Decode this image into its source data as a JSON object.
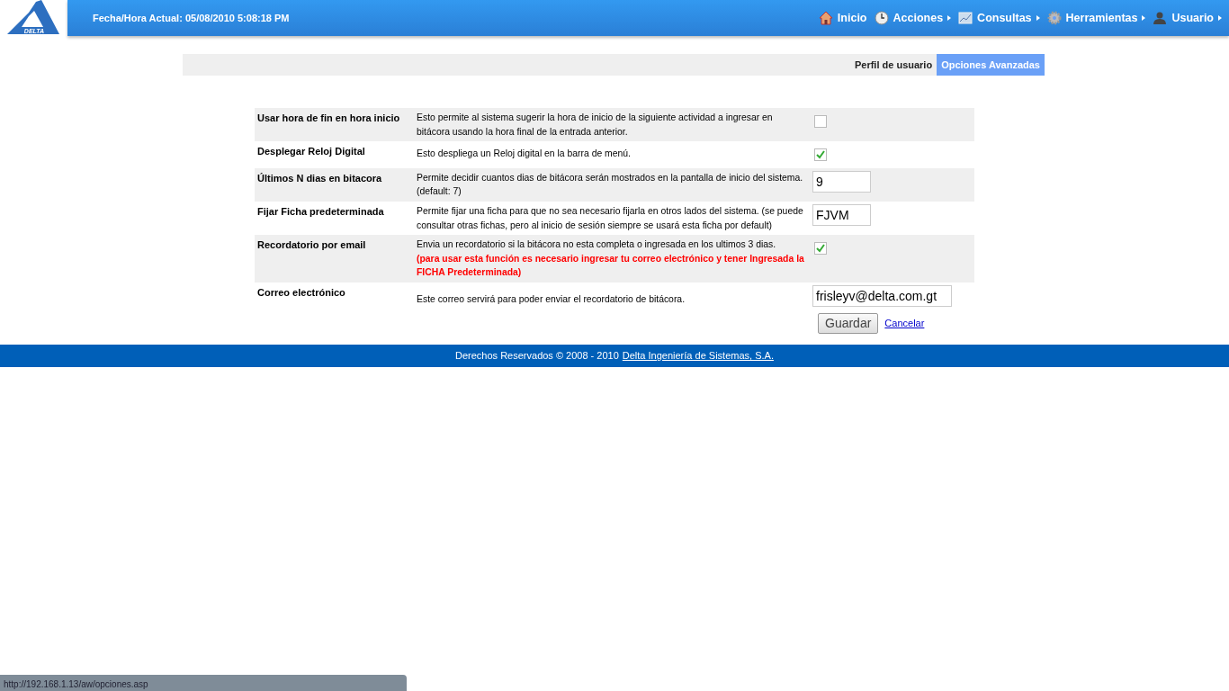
{
  "header": {
    "logo_text": "DELTA",
    "datetime": "Fecha/Hora Actual: 05/08/2010 5:08:18 PM"
  },
  "menu": [
    {
      "label": "Inicio",
      "has_submenu": false
    },
    {
      "label": "Acciones",
      "has_submenu": true
    },
    {
      "label": "Consultas",
      "has_submenu": true
    },
    {
      "label": "Herramientas",
      "has_submenu": true
    },
    {
      "label": "Usuario",
      "has_submenu": true
    }
  ],
  "tabs": [
    {
      "label": "Perfil de usuario",
      "selected": false
    },
    {
      "label": "Opciones Avanzadas",
      "selected": true
    }
  ],
  "options": [
    {
      "label": "Usar hora de fin en hora inicio",
      "description": "Esto permite al sistema sugerir la hora de inicio de la siguiente actividad a ingresar en bitácora usando la hora final de la entrada anterior.",
      "kind": "checkbox",
      "checked": false
    },
    {
      "label": "Desplegar Reloj Digital",
      "description": "Esto despliega un Reloj digital en la barra de menú.",
      "kind": "checkbox",
      "checked": true
    },
    {
      "label": "Últimos N dias en bitacora",
      "description": "Permite decidir cuantos dias de bitácora serán mostrados en la pantalla de inicio del sistema. (default: 7)",
      "kind": "text",
      "value": "9"
    },
    {
      "label": "Fijar Ficha predeterminada",
      "description": "Permite fijar una ficha para que no sea necesario fijarla en otros lados del sistema. (se puede consultar otras fichas, pero al inicio de sesión siempre se usará esta ficha por default)",
      "kind": "text",
      "value": "FJVM"
    },
    {
      "label": "Recordatorio por email",
      "description": "Envia un recordatorio si la bitácora no esta completa o ingresada en los ultimos 3 dias.",
      "warning": "(para usar esta función es necesario ingresar tu correo electrónico y tener Ingresada la FICHA Predeterminada)",
      "kind": "checkbox",
      "checked": true
    },
    {
      "label": "Correo electrónico",
      "description": "Este correo servirá para poder enviar el recordatorio de bitácora.",
      "kind": "text",
      "value": "frisleyv@delta.com.gt"
    }
  ],
  "actions": {
    "save": "Guardar",
    "cancel": "Cancelar"
  },
  "footer": {
    "text": "Derechos Reservados © 2008 - 2010",
    "link": "Delta Ingeniería de Sistemas, S.A."
  },
  "status_bar": "http://192.168.1.13/aw/opciones.asp"
}
